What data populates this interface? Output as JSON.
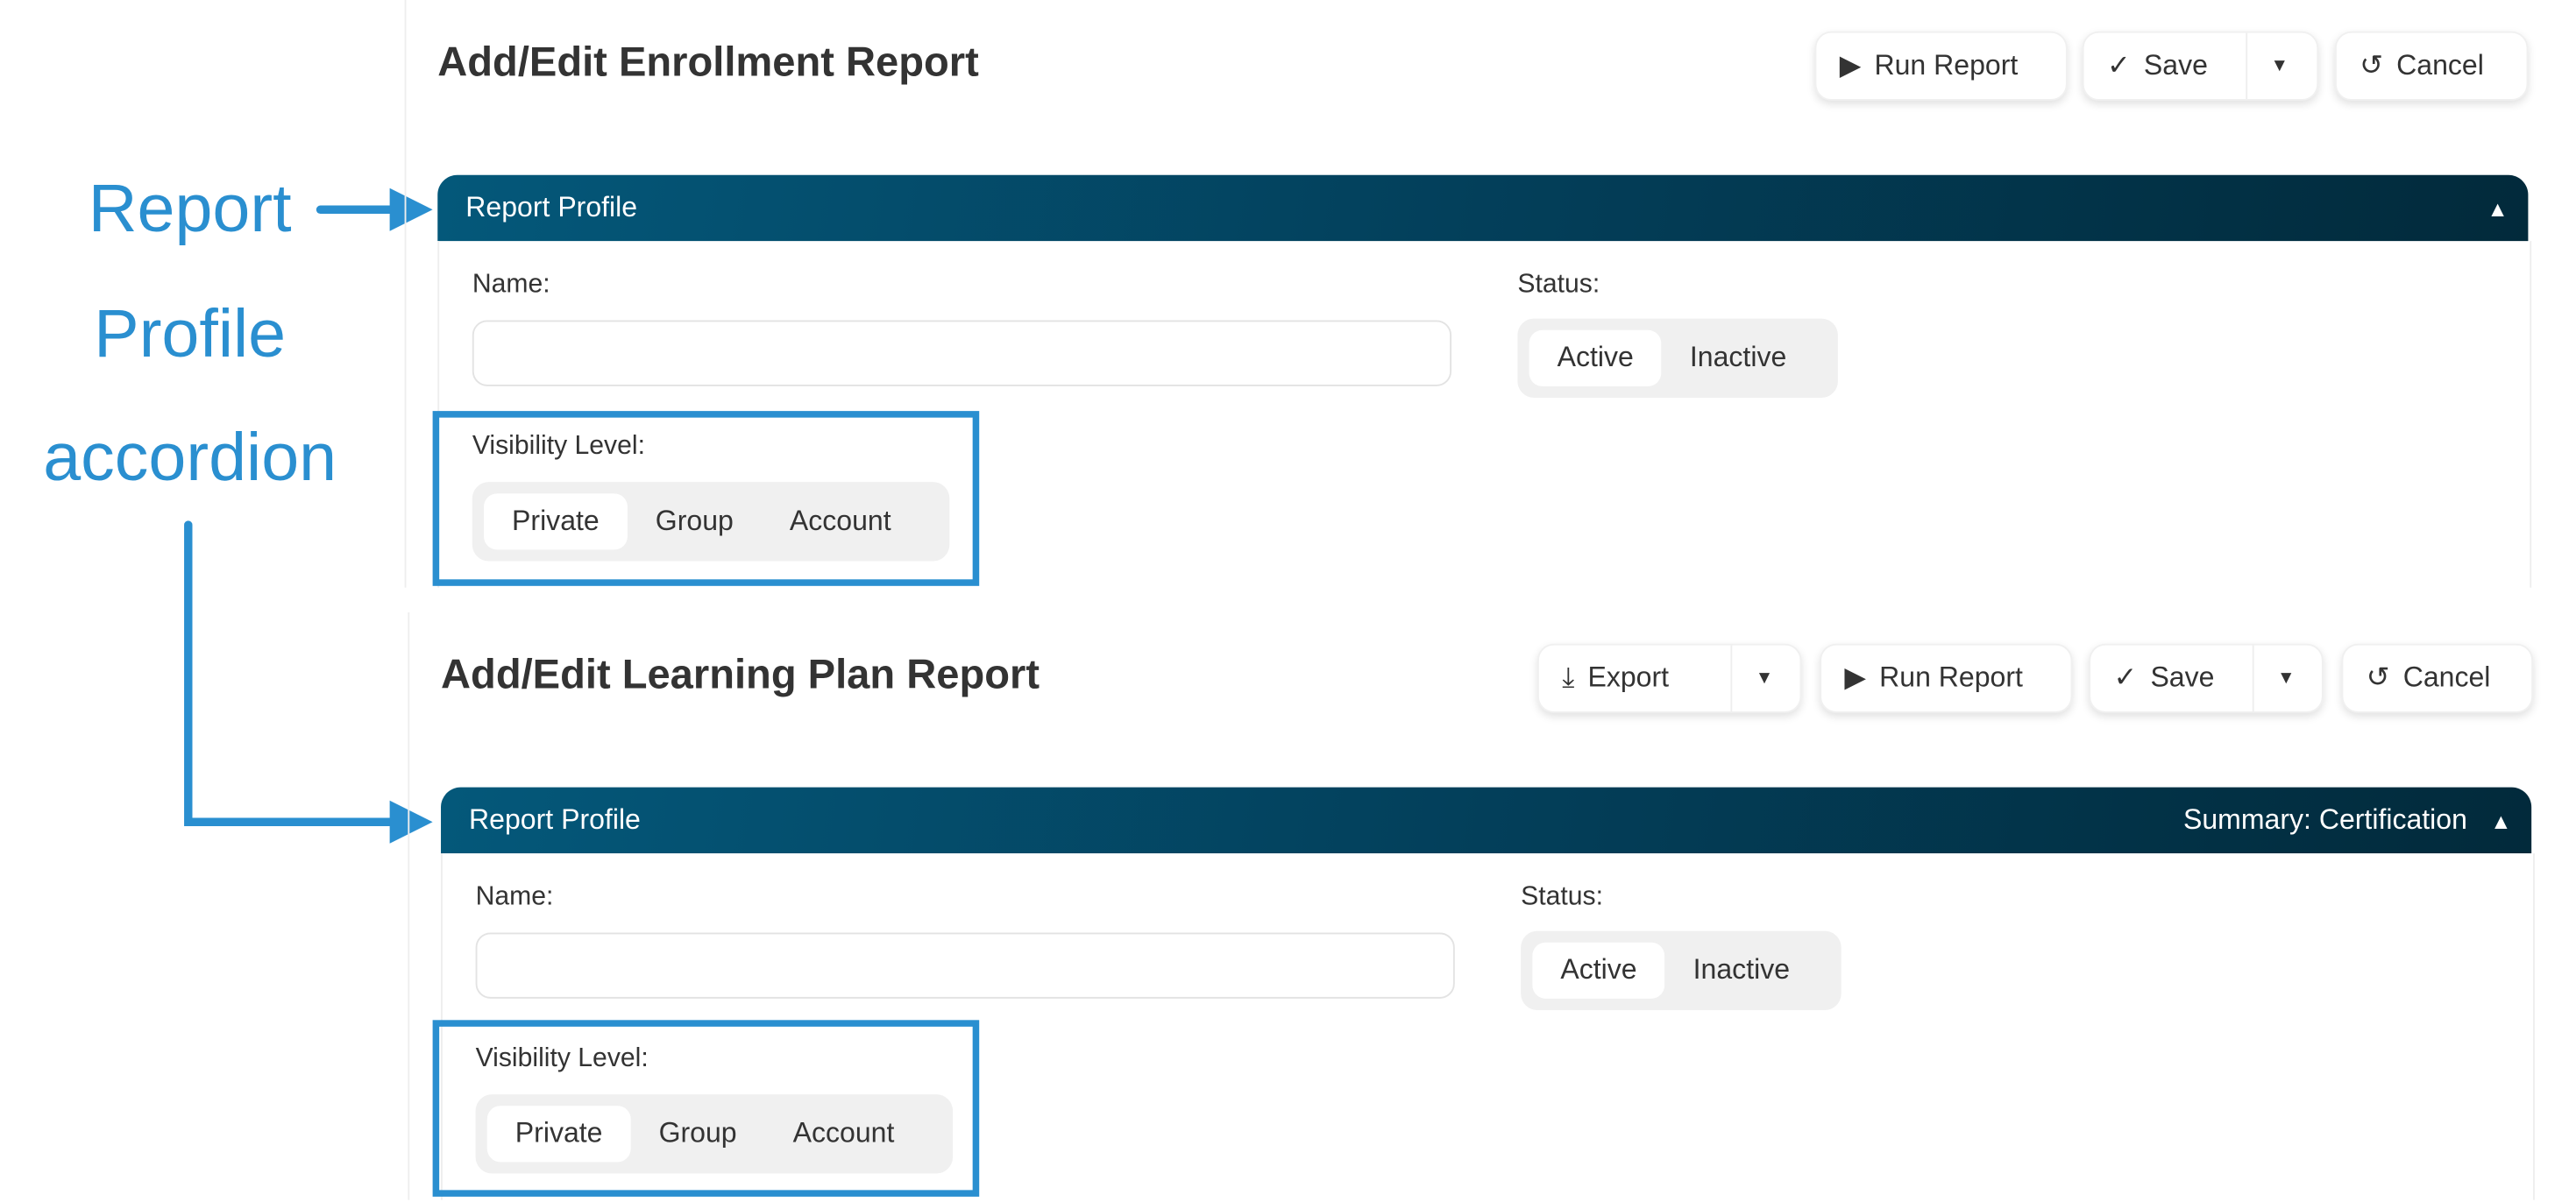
{
  "annotation": {
    "lines": [
      "Report",
      "Profile",
      "accordion"
    ],
    "color": "#2a8fd0"
  },
  "enrollment": {
    "title": "Add/Edit Enrollment Report",
    "buttons": {
      "run_report": "Run Report",
      "save": "Save",
      "cancel": "Cancel"
    },
    "accordion": {
      "title": "Report Profile",
      "expanded": true
    },
    "name_label": "Name:",
    "name_value": "",
    "status_label": "Status:",
    "status_options": [
      "Active",
      "Inactive"
    ],
    "status_selected": "Active",
    "visibility_label": "Visibility Level:",
    "visibility_options": [
      "Private",
      "Group",
      "Account"
    ],
    "visibility_selected": "Private"
  },
  "learning_plan": {
    "title": "Add/Edit Learning Plan Report",
    "buttons": {
      "export": "Export",
      "run_report": "Run Report",
      "save": "Save",
      "cancel": "Cancel"
    },
    "accordion": {
      "title": "Report Profile",
      "summary": "Summary: Certification",
      "expanded": true
    },
    "name_label": "Name:",
    "name_value": "",
    "status_label": "Status:",
    "status_options": [
      "Active",
      "Inactive"
    ],
    "status_selected": "Active",
    "visibility_label": "Visibility Level:",
    "visibility_options": [
      "Private",
      "Group",
      "Account"
    ],
    "visibility_selected": "Private"
  },
  "colors": {
    "accordion_header": "#033f5a",
    "highlight": "#2a8fd0"
  }
}
